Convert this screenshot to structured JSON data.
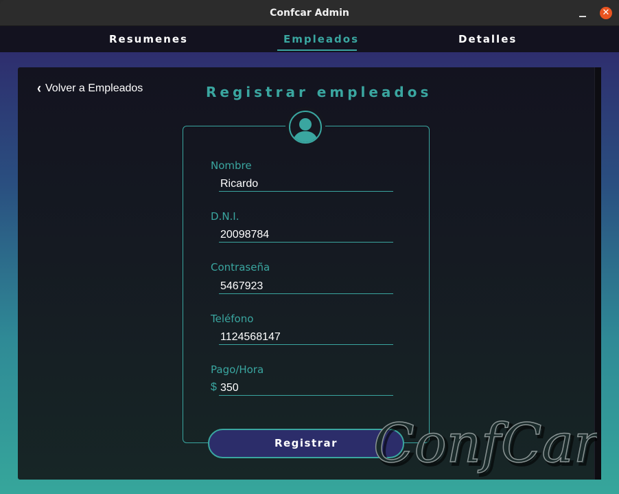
{
  "window": {
    "title": "Confcar Admin",
    "close_glyph": "✕"
  },
  "nav": {
    "tabs": [
      {
        "label": "Resumenes",
        "active": false
      },
      {
        "label": "Empleados",
        "active": true
      },
      {
        "label": "Detalles",
        "active": false
      }
    ]
  },
  "page": {
    "back_label": "Volver a Empleados",
    "title": "Registrar empleados"
  },
  "form": {
    "fields": [
      {
        "label": "Nombre",
        "value": "Ricardo"
      },
      {
        "label": "D.N.I.",
        "value": "20098784"
      },
      {
        "label": "Contraseña",
        "value": "5467923"
      },
      {
        "label": "Teléfono",
        "value": "1124568147"
      },
      {
        "label": "Pago/Hora",
        "value": "350",
        "prefix": "$"
      }
    ],
    "submit_label": "Registrar"
  },
  "brand": {
    "logo_text": "ConfCar"
  },
  "colors": {
    "accent": "#3aa6a0",
    "button_bg": "#2c2d6a",
    "close_button": "#e95420"
  },
  "icons": {
    "back": "chevron-left-icon",
    "avatar": "user-avatar-icon",
    "minimize": "minimize-icon",
    "close": "close-icon"
  }
}
